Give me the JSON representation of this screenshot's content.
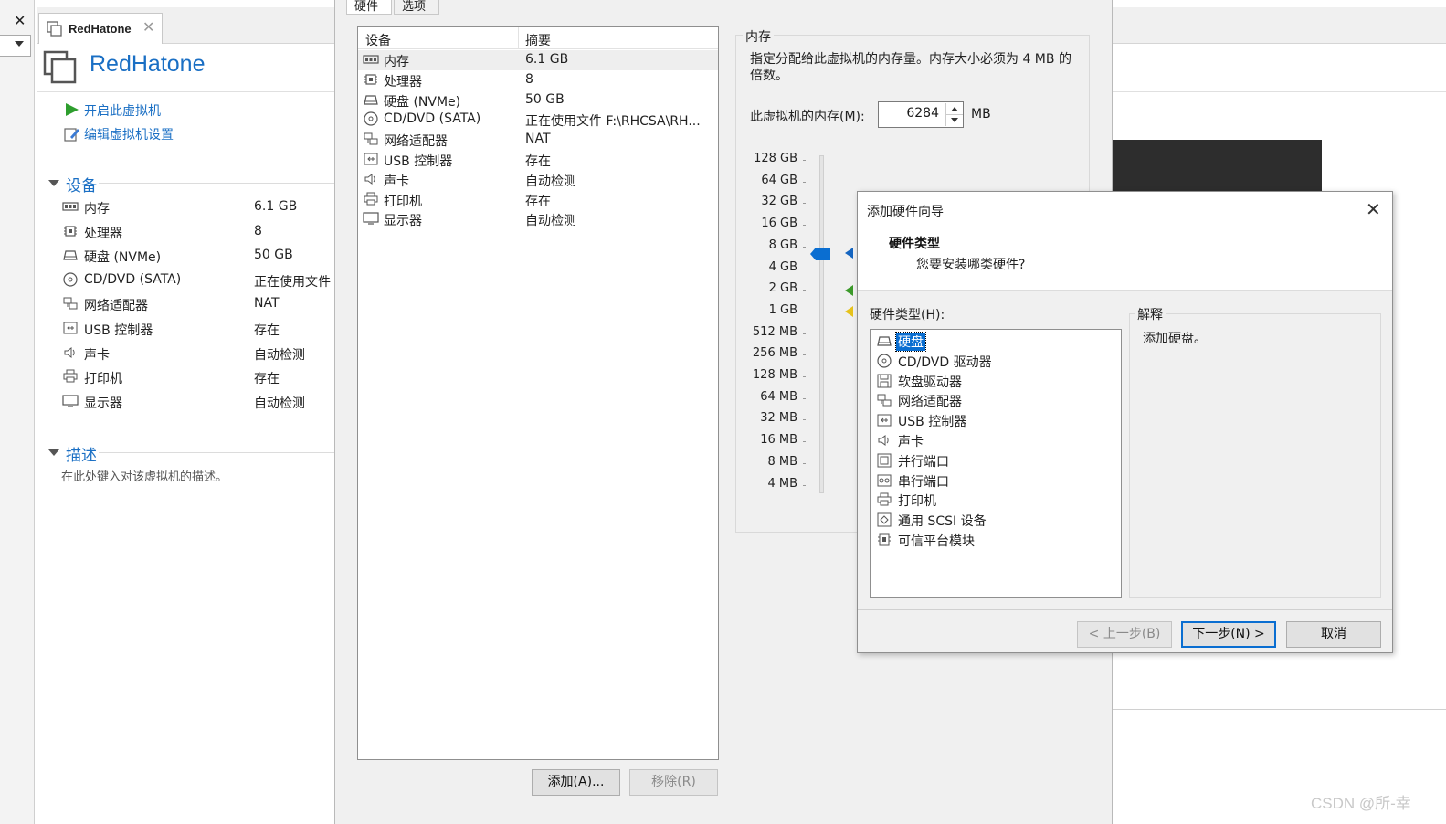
{
  "left_strip": {
    "close_glyph": "✕"
  },
  "vm_tab": {
    "title": "RedHatone",
    "close_glyph": "✕"
  },
  "summary": {
    "title": "RedHatone",
    "actions": [
      {
        "icon": "play-icon",
        "label": "开启此虚拟机"
      },
      {
        "icon": "edit-settings-icon",
        "label": "编辑虚拟机设置"
      }
    ],
    "devices_heading": "设备",
    "devices": [
      {
        "icon": "memory-icon",
        "name": "内存",
        "value": "6.1 GB"
      },
      {
        "icon": "processor-icon",
        "name": "处理器",
        "value": "8"
      },
      {
        "icon": "harddisk-icon",
        "name": "硬盘 (NVMe)",
        "value": "50 GB"
      },
      {
        "icon": "cd-dvd-icon",
        "name": "CD/DVD (SATA)",
        "value": "正在使用文件"
      },
      {
        "icon": "network-adapter-icon",
        "name": "网络适配器",
        "value": "NAT"
      },
      {
        "icon": "usb-icon",
        "name": "USB 控制器",
        "value": "存在"
      },
      {
        "icon": "sound-icon",
        "name": "声卡",
        "value": "自动检测"
      },
      {
        "icon": "printer-icon",
        "name": "打印机",
        "value": "存在"
      },
      {
        "icon": "display-icon",
        "name": "显示器",
        "value": "自动检测"
      }
    ],
    "description_heading": "描述",
    "description_placeholder": "在此处键入对该虚拟机的描述。"
  },
  "settings": {
    "tabs": [
      "硬件",
      "选项"
    ],
    "device_list": {
      "col_device": "设备",
      "col_summary": "摘要",
      "rows": [
        {
          "icon": "memory-icon",
          "name": "内存",
          "value": "6.1 GB",
          "selected": true
        },
        {
          "icon": "processor-icon",
          "name": "处理器",
          "value": "8"
        },
        {
          "icon": "harddisk-icon",
          "name": "硬盘 (NVMe)",
          "value": "50 GB"
        },
        {
          "icon": "cd-dvd-icon",
          "name": "CD/DVD (SATA)",
          "value": "正在使用文件 F:\\RHCSA\\RH..."
        },
        {
          "icon": "network-adapter-icon",
          "name": "网络适配器",
          "value": "NAT"
        },
        {
          "icon": "usb-icon",
          "name": "USB 控制器",
          "value": "存在"
        },
        {
          "icon": "sound-icon",
          "name": "声卡",
          "value": "自动检测"
        },
        {
          "icon": "printer-icon",
          "name": "打印机",
          "value": "存在"
        },
        {
          "icon": "display-icon",
          "name": "显示器",
          "value": "自动检测"
        }
      ]
    },
    "add_button": "添加(A)...",
    "remove_button": "移除(R)",
    "memory": {
      "group_label": "内存",
      "description": "指定分配给此虚拟机的内存量。内存大小必须为 4 MB 的倍数。",
      "field_label": "此虚拟机的内存(M):",
      "value": "6284",
      "unit": "MB",
      "scale_labels": [
        "128 GB",
        "64 GB",
        "32 GB",
        "16 GB",
        "8 GB",
        "4 GB",
        "2 GB",
        "1 GB",
        "512 MB",
        "256 MB",
        "128 MB",
        "64 MB",
        "32 MB",
        "16 MB",
        "8 MB",
        "4 MB"
      ],
      "marker_colors": {
        "slider": "#0a6ed1",
        "blue": "#1565c0",
        "green": "#3c9a2a",
        "yellow": "#e6c21b"
      }
    }
  },
  "wizard": {
    "title": "添加硬件向导",
    "close_glyph": "✕",
    "heading": "硬件类型",
    "subheading": "您要安装哪类硬件?",
    "list_label": "硬件类型(H):",
    "items": [
      {
        "icon": "harddisk-icon",
        "label": "硬盘",
        "selected": true
      },
      {
        "icon": "cd-dvd-icon",
        "label": "CD/DVD 驱动器"
      },
      {
        "icon": "floppy-icon",
        "label": "软盘驱动器"
      },
      {
        "icon": "network-adapter-icon",
        "label": "网络适配器"
      },
      {
        "icon": "usb-icon",
        "label": "USB 控制器"
      },
      {
        "icon": "sound-icon",
        "label": "声卡"
      },
      {
        "icon": "parallel-port-icon",
        "label": "并行端口"
      },
      {
        "icon": "serial-port-icon",
        "label": "串行端口"
      },
      {
        "icon": "printer-icon",
        "label": "打印机"
      },
      {
        "icon": "scsi-icon",
        "label": "通用 SCSI 设备"
      },
      {
        "icon": "tpm-icon",
        "label": "可信平台模块"
      }
    ],
    "explanation_label": "解释",
    "explanation_text": "添加硬盘。",
    "back_button": "< 上一步(B)",
    "next_button": "下一步(N) >",
    "cancel_button": "取消"
  },
  "watermark": "CSDN @所-幸"
}
